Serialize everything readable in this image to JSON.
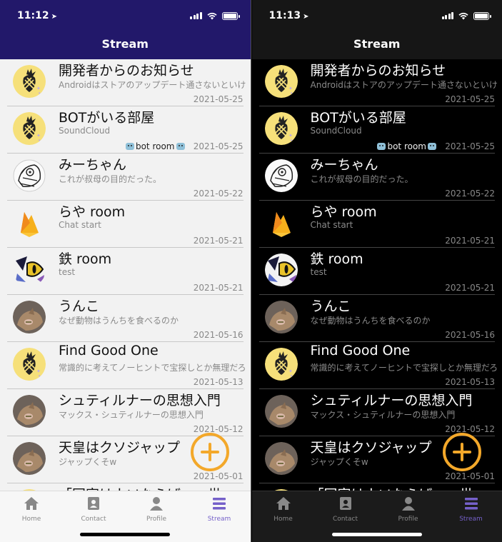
{
  "status_bar": {
    "light_time": "11:12",
    "dark_time": "11:13"
  },
  "nav": {
    "title": "Stream"
  },
  "rooms": [
    {
      "name": "開発者からのお知らせ",
      "subtitle": "Androidはストアのアップデート通さないといけないので",
      "date": "2021-05-25",
      "badge": "",
      "avatar": "pineapple-avatar"
    },
    {
      "name": "BOTがいる部屋",
      "subtitle": "SoundCloud",
      "date": "2021-05-25",
      "badge": "bot room",
      "avatar": "pineapple-avatar"
    },
    {
      "name": "みーちゃん",
      "subtitle": "これが叔母の目的だった。",
      "date": "2021-05-22",
      "badge": "",
      "avatar": "manga-avatar"
    },
    {
      "name": "らや room",
      "subtitle": "Chat start",
      "date": "2021-05-21",
      "badge": "",
      "avatar": "firebase-avatar"
    },
    {
      "name": "鉄 room",
      "subtitle": "test",
      "date": "2021-05-21",
      "badge": "",
      "avatar": "abstract-avatar"
    },
    {
      "name": "うんこ",
      "subtitle": "なぜ動物はうんちを食べるのか",
      "date": "2021-05-16",
      "badge": "",
      "avatar": "cat-avatar"
    },
    {
      "name": "Find Good One",
      "subtitle": "常識的に考えてノーヒントで宝探しとか無理だろ",
      "date": "2021-05-13",
      "badge": "",
      "avatar": "pineapple-avatar"
    },
    {
      "name": "シュティルナーの思想入門",
      "subtitle": "マックス・シュティルナーの思想入門",
      "date": "2021-05-12",
      "badge": "",
      "avatar": "cat-avatar"
    },
    {
      "name": "天皇はクソジャップ",
      "subtitle": "ジャップくそw",
      "date": "2021-05-01",
      "badge": "",
      "avatar": "cat-avatar"
    },
    {
      "name": "「国家はウソならば・・世…",
      "subtitle": "",
      "date": "",
      "badge": "",
      "avatar": "pineapple-avatar"
    }
  ],
  "tabs": [
    {
      "label": "Home",
      "icon": "home-icon",
      "active": false
    },
    {
      "label": "Contact",
      "icon": "contact-icon",
      "active": false
    },
    {
      "label": "Profile",
      "icon": "profile-icon",
      "active": false
    },
    {
      "label": "Stream",
      "icon": "stream-icon",
      "active": true
    }
  ],
  "colors": {
    "light_navbar": "#22186a",
    "accent": "#7560c9",
    "fab": "#f3a82a"
  }
}
